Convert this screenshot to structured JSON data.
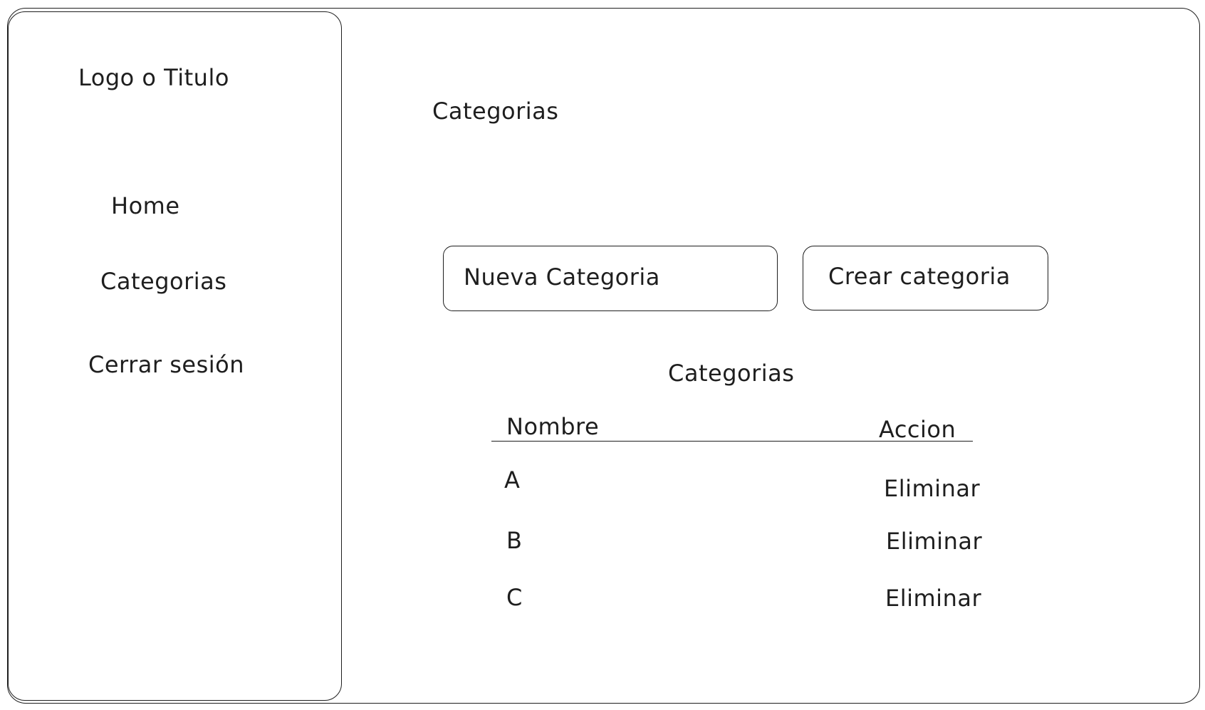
{
  "sidebar": {
    "logo_text": "Logo o Titulo",
    "items": [
      {
        "label": "Home"
      },
      {
        "label": "Categorias"
      },
      {
        "label": "Cerrar sesión"
      }
    ]
  },
  "main": {
    "page_title": "Categorias",
    "new_category_input": {
      "placeholder": "Nueva Categoria"
    },
    "create_button_label": "Crear categoria",
    "table": {
      "title": "Categorias",
      "columns": [
        "Nombre",
        "Accion"
      ],
      "rows": [
        {
          "name": "A",
          "action": "Eliminar"
        },
        {
          "name": "B",
          "action": "Eliminar"
        },
        {
          "name": "C",
          "action": "Eliminar"
        }
      ]
    }
  }
}
